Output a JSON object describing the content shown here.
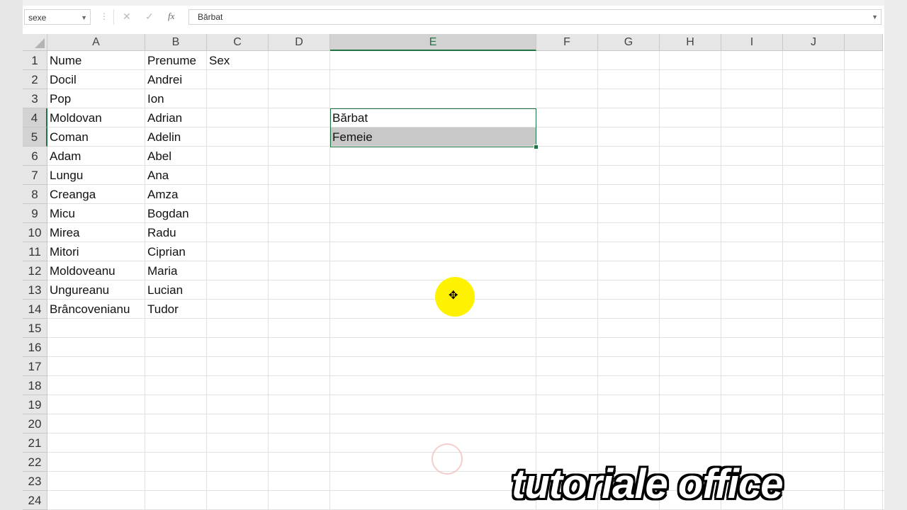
{
  "formula_bar": {
    "name_box": "sexe",
    "cancel_icon": "✕",
    "confirm_icon": "✓",
    "fx_icon": "fx",
    "value": "Bărbat"
  },
  "columns": [
    "A",
    "B",
    "C",
    "D",
    "E",
    "F",
    "G",
    "H",
    "I",
    "J"
  ],
  "rows": [
    "1",
    "2",
    "3",
    "4",
    "5",
    "6",
    "7",
    "8",
    "9",
    "10",
    "11",
    "12",
    "13",
    "14",
    "15",
    "16",
    "17",
    "18",
    "19",
    "20",
    "21",
    "22",
    "23",
    "24"
  ],
  "cells": {
    "A": [
      "Nume",
      "Docil",
      "Pop",
      "Moldovan",
      "Coman",
      "Adam",
      "Lungu",
      "Creanga",
      "Micu",
      "Mirea",
      "Mitori",
      "Moldoveanu",
      "Ungureanu",
      "Brâncovenianu"
    ],
    "B": [
      "Prenume",
      "Andrei",
      "Ion",
      "Adrian",
      "Adelin",
      "Abel",
      "Ana",
      "Amza",
      "Bogdan",
      "Radu",
      "Ciprian",
      "Maria",
      "Lucian",
      "Tudor"
    ],
    "C": [
      "Sex"
    ],
    "E4": "Bărbat",
    "E5": "Femeie"
  },
  "selection": {
    "range": "E4:E5",
    "selected_column": "E"
  },
  "watermark": "tutoriale office",
  "colors": {
    "accent": "#217346",
    "highlight": "#fff200"
  }
}
